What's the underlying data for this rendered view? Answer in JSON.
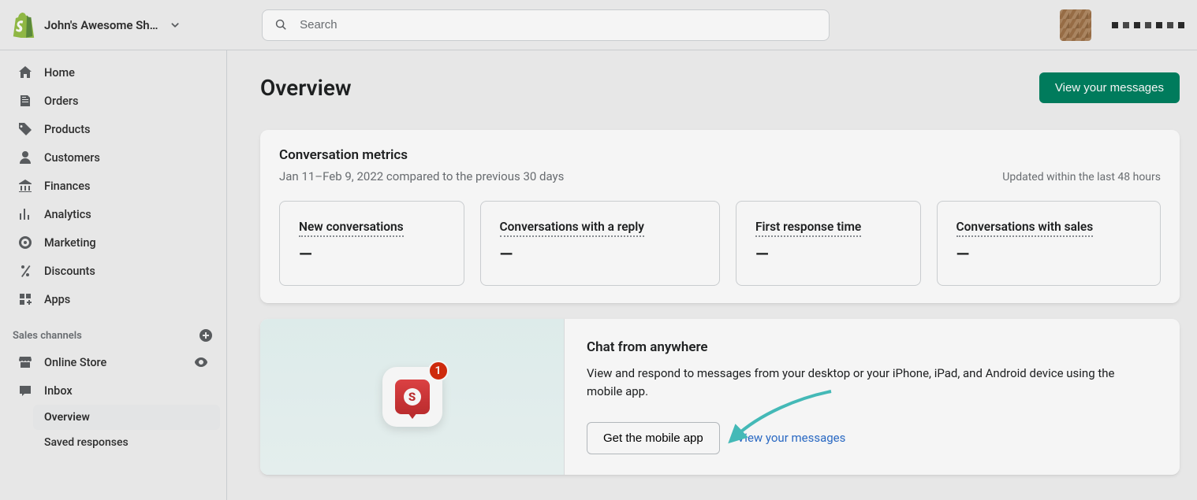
{
  "topbar": {
    "store_name": "John's Awesome Sh…",
    "search_placeholder": "Search"
  },
  "sidebar": {
    "items": [
      {
        "label": "Home"
      },
      {
        "label": "Orders"
      },
      {
        "label": "Products"
      },
      {
        "label": "Customers"
      },
      {
        "label": "Finances"
      },
      {
        "label": "Analytics"
      },
      {
        "label": "Marketing"
      },
      {
        "label": "Discounts"
      },
      {
        "label": "Apps"
      }
    ],
    "channels_heading": "Sales channels",
    "channels": [
      {
        "label": "Online Store"
      },
      {
        "label": "Inbox"
      }
    ],
    "inbox_sub": [
      {
        "label": "Overview",
        "active": true
      },
      {
        "label": "Saved responses",
        "active": false
      }
    ]
  },
  "page": {
    "title": "Overview",
    "view_messages_btn": "View your messages"
  },
  "metrics": {
    "section_title": "Conversation metrics",
    "date_range": "Jan 11–Feb 9, 2022 compared to the previous 30 days",
    "updated_text": "Updated within the last 48 hours",
    "cards": [
      {
        "label": "New conversations",
        "value": "—"
      },
      {
        "label": "Conversations with a reply",
        "value": "—"
      },
      {
        "label": "First response time",
        "value": "—"
      },
      {
        "label": "Conversations with sales",
        "value": "—"
      }
    ]
  },
  "promo": {
    "badge_count": "1",
    "title": "Chat from anywhere",
    "body": "View and respond to messages from your desktop or your iPhone, iPad, and Android device using the mobile app.",
    "primary_btn": "Get the mobile app",
    "link_text": "View your messages"
  },
  "colors": {
    "accent_green": "#008060",
    "annotation_arrow": "#47c1bf",
    "link_blue": "#2c6ecb"
  }
}
